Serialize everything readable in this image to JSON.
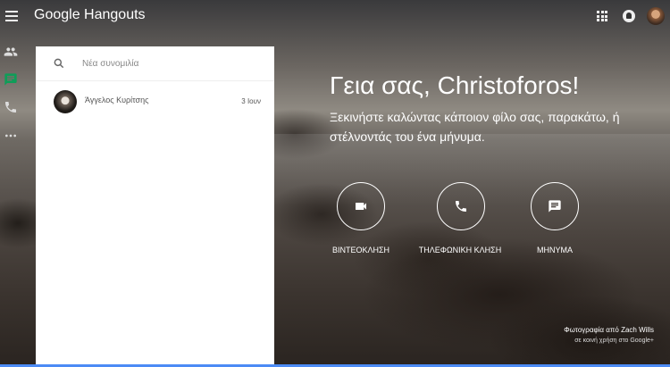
{
  "app": {
    "title": "Google Hangouts"
  },
  "icons": {
    "menu": "menu-icon",
    "apps": "apps-icon",
    "notifications": "notifications-icon",
    "contacts": "contacts-icon",
    "messages": "chat-icon",
    "calls": "phone-icon",
    "more": "more-icon"
  },
  "colors": {
    "accent": "#0f9d58",
    "bottom_bar": "#4c8bf5"
  },
  "panel": {
    "search": {
      "placeholder": "Νέα συνομιλία"
    },
    "conversations": [
      {
        "name": "Άγγελος Κυρίτσης",
        "date": "3 Ιουν"
      }
    ]
  },
  "main": {
    "greeting": "Γεια σας, Christoforos!",
    "subtitle": "Ξεκινήστε καλώντας κάποιον φίλο σας, παρακάτω, ή στέλνοντάς του ένα μήνυμα.",
    "actions": [
      {
        "label": "ΒΙΝΤΕΟΚΛΗΣΗ",
        "icon": "videocam-icon"
      },
      {
        "label": "ΤΗΛΕΦΩΝΙΚΗ ΚΛΗΣΗ",
        "icon": "phone-icon"
      },
      {
        "label": "ΜΗΝΥΜΑ",
        "icon": "message-icon"
      }
    ],
    "credit": {
      "line1": "Φωτογραφία από Zach Wills",
      "line2": "σε κοινή χρήση στο Google+"
    }
  }
}
